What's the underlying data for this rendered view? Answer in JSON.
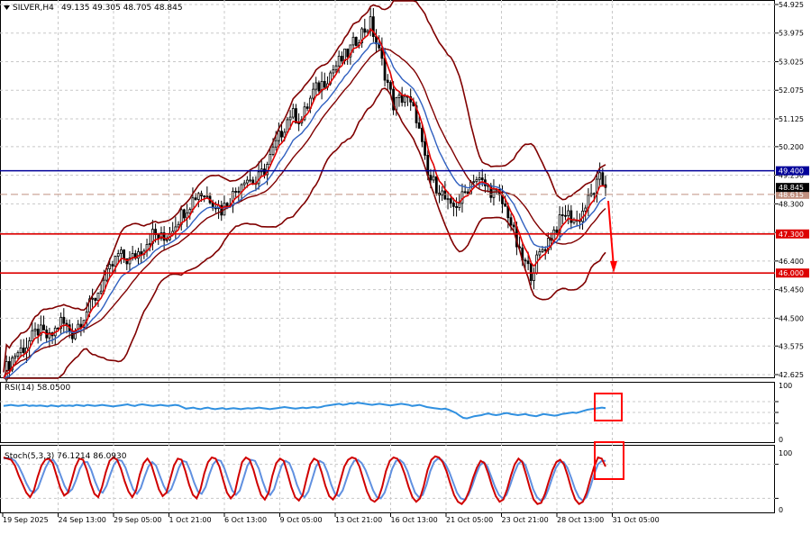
{
  "header": {
    "symbol": "SILVER,H4",
    "ohlc": "49.135 49.305 48.705 48.845",
    "rsi_label": "RSI(14) 58.0500",
    "stoch_label": "Stoch(5,3,3) 76.1214 86.0930"
  },
  "colors": {
    "background": "#ffffff",
    "grid": "#c8c8c8",
    "candles": "#000000",
    "bollinger": "#800000",
    "ema_fast": "#e00000",
    "ema_slow": "#3060c0",
    "horizontal_blue": "#000099",
    "horizontal_red": "#dd0000",
    "dashed_level": "#c09080",
    "rsi_line": "#3090e0",
    "stoch_main": "#d00000",
    "stoch_signal": "#6090e0",
    "annotation": "#ff0000"
  },
  "chart_data": [
    {
      "type": "candlestick",
      "title": "SILVER,H4",
      "ylim": [
        42.625,
        54.925
      ],
      "y_ticks": [
        "54.925",
        "53.975",
        "53.025",
        "52.075",
        "51.125",
        "50.200",
        "49.250",
        "48.300",
        "47.350",
        "46.400",
        "45.450",
        "44.500",
        "43.575",
        "42.625"
      ],
      "x_ticks": [
        "19 Sep 2025",
        "24 Sep 13:00",
        "29 Sep 05:00",
        "1 Oct 21:00",
        "6 Oct 13:00",
        "9 Oct 05:00",
        "13 Oct 21:00",
        "16 Oct 13:00",
        "21 Oct 05:00",
        "23 Oct 21:00",
        "28 Oct 13:00",
        "31 Oct 05:00"
      ],
      "price_path": [
        [
          0,
          42.7
        ],
        [
          4,
          43.3
        ],
        [
          8,
          43.6
        ],
        [
          12,
          44.1
        ],
        [
          16,
          43.8
        ],
        [
          20,
          44.4
        ],
        [
          24,
          44.0
        ],
        [
          28,
          44.6
        ],
        [
          32,
          45.2
        ],
        [
          36,
          45.9
        ],
        [
          40,
          46.6
        ],
        [
          44,
          46.4
        ],
        [
          48,
          46.8
        ],
        [
          52,
          47.3
        ],
        [
          56,
          47.1
        ],
        [
          60,
          47.7
        ],
        [
          64,
          48.2
        ],
        [
          68,
          48.7
        ],
        [
          72,
          48.5
        ],
        [
          76,
          48.1
        ],
        [
          80,
          48.6
        ],
        [
          84,
          49.2
        ],
        [
          88,
          49.0
        ],
        [
          92,
          49.6
        ],
        [
          96,
          50.5
        ],
        [
          100,
          51.3
        ],
        [
          104,
          51.1
        ],
        [
          108,
          52.0
        ],
        [
          112,
          52.4
        ],
        [
          116,
          52.9
        ],
        [
          120,
          53.3
        ],
        [
          124,
          53.9
        ],
        [
          128,
          54.3
        ],
        [
          132,
          53.0
        ],
        [
          136,
          51.6
        ],
        [
          140,
          51.9
        ],
        [
          144,
          51.2
        ],
        [
          148,
          49.2
        ],
        [
          152,
          48.8
        ],
        [
          156,
          48.1
        ],
        [
          160,
          48.5
        ],
        [
          164,
          49.2
        ],
        [
          168,
          48.9
        ],
        [
          172,
          48.6
        ],
        [
          176,
          48.0
        ],
        [
          180,
          46.6
        ],
        [
          184,
          46.0
        ],
        [
          188,
          46.8
        ],
        [
          192,
          47.4
        ],
        [
          196,
          48.0
        ],
        [
          200,
          47.7
        ],
        [
          204,
          48.4
        ],
        [
          208,
          49.1
        ],
        [
          210,
          48.85
        ]
      ],
      "last_price": "48.845",
      "levels": [
        {
          "value": 49.4,
          "label": "49.400",
          "color": "#000099"
        },
        {
          "value": 47.3,
          "label": "47.300",
          "color": "#dd0000"
        },
        {
          "value": 46.0,
          "label": "46.000",
          "color": "#dd0000"
        },
        {
          "value": 48.615,
          "label": "48.615",
          "color": "#c09080",
          "dashed": true
        },
        {
          "value": 48.845,
          "label": "48.845",
          "color": "#000000"
        }
      ],
      "bollinger_period": 20
    },
    {
      "type": "line",
      "title": "RSI(14) 58.0500",
      "ylim": [
        0,
        100
      ],
      "y_ticks": [
        "100",
        "0"
      ],
      "levels": [
        70,
        50,
        30
      ],
      "values": [
        62,
        63,
        64,
        63,
        62,
        63,
        64,
        62,
        63,
        62,
        63,
        62,
        61,
        63,
        62,
        61,
        63,
        62,
        63,
        62,
        64,
        63,
        62,
        64,
        63,
        62,
        63,
        64,
        63,
        62,
        61,
        62,
        63,
        64,
        65,
        63,
        62,
        64,
        65,
        64,
        63,
        62,
        63,
        64,
        63,
        62,
        63,
        64,
        63,
        60,
        57,
        58,
        59,
        57,
        56,
        58,
        59,
        57,
        56,
        57,
        58,
        56,
        57,
        58,
        57,
        56,
        57,
        58,
        57,
        58,
        59,
        58,
        57,
        56,
        57,
        58,
        59,
        60,
        59,
        58,
        57,
        58,
        59,
        58,
        59,
        60,
        59,
        60,
        62,
        63,
        64,
        65,
        66,
        64,
        65,
        67,
        66,
        68,
        67,
        66,
        65,
        64,
        65,
        66,
        65,
        64,
        63,
        64,
        65,
        66,
        65,
        64,
        62,
        63,
        64,
        62,
        60,
        59,
        58,
        57,
        56,
        57,
        55,
        52,
        49,
        44,
        40,
        39,
        41,
        43,
        44,
        45,
        47,
        48,
        46,
        45,
        46,
        48,
        49,
        47,
        46,
        45,
        46,
        47,
        45,
        44,
        43,
        45,
        47,
        46,
        45,
        44,
        45,
        47,
        48,
        49,
        50,
        49,
        51,
        53,
        55,
        56,
        57,
        58,
        59,
        58
      ],
      "last_value": "58.0500"
    },
    {
      "type": "line",
      "title": "Stoch(5,3,3) 76.1214 86.0930",
      "ylim": [
        0,
        100
      ],
      "y_ticks": [
        "100",
        "0"
      ],
      "levels": [
        80,
        20
      ],
      "series": [
        {
          "name": "Main",
          "values": [
            92,
            90,
            88,
            78,
            60,
            45,
            30,
            22,
            34,
            58,
            78,
            88,
            90,
            82,
            60,
            38,
            25,
            30,
            52,
            76,
            90,
            88,
            70,
            46,
            28,
            22,
            40,
            66,
            86,
            92,
            88,
            72,
            50,
            32,
            22,
            34,
            62,
            82,
            90,
            80,
            58,
            36,
            24,
            30,
            54,
            78,
            90,
            88,
            68,
            44,
            26,
            20,
            36,
            64,
            84,
            92,
            90,
            76,
            52,
            30,
            20,
            28,
            58,
            84,
            92,
            88,
            70,
            46,
            26,
            18,
            30,
            60,
            82,
            90,
            86,
            64,
            40,
            22,
            16,
            26,
            54,
            80,
            90,
            86,
            66,
            42,
            24,
            18,
            28,
            52,
            76,
            88,
            92,
            90,
            76,
            54,
            32,
            18,
            14,
            20,
            40,
            68,
            86,
            92,
            90,
            80,
            62,
            40,
            22,
            14,
            20,
            42,
            70,
            88,
            94,
            92,
            84,
            68,
            46,
            26,
            14,
            10,
            18,
            34,
            56,
            74,
            86,
            82,
            64,
            42,
            24,
            14,
            18,
            36,
            60,
            80,
            90,
            84,
            62,
            38,
            18,
            10,
            12,
            28,
            50,
            70,
            84,
            88,
            80,
            60,
            36,
            18,
            10,
            14,
            30,
            54,
            76,
            92,
            90,
            76
          ],
          "last_value": "76.1214"
        },
        {
          "name": "Signal",
          "values": [
            90,
            91,
            90,
            86,
            76,
            62,
            46,
            34,
            30,
            38,
            56,
            74,
            86,
            88,
            78,
            60,
            42,
            30,
            36,
            52,
            72,
            84,
            84,
            70,
            50,
            34,
            30,
            42,
            62,
            80,
            88,
            86,
            74,
            54,
            36,
            28,
            38,
            58,
            76,
            84,
            78,
            60,
            42,
            30,
            36,
            54,
            74,
            86,
            84,
            68,
            48,
            32,
            28,
            40,
            62,
            80,
            88,
            86,
            72,
            52,
            34,
            26,
            34,
            56,
            78,
            88,
            86,
            72,
            50,
            32,
            26,
            36,
            58,
            78,
            86,
            82,
            66,
            44,
            28,
            22,
            32,
            54,
            76,
            86,
            82,
            66,
            44,
            28,
            24,
            34,
            54,
            74,
            86,
            88,
            82,
            70,
            52,
            34,
            22,
            20,
            30,
            50,
            72,
            86,
            88,
            82,
            68,
            48,
            30,
            22,
            26,
            44,
            68,
            84,
            90,
            88,
            80,
            66,
            48,
            30,
            20,
            18,
            26,
            42,
            62,
            78,
            84,
            76,
            58,
            40,
            26,
            20,
            26,
            44,
            64,
            80,
            86,
            78,
            58,
            36,
            22,
            16,
            20,
            36,
            56,
            74,
            84,
            84,
            74,
            56,
            36,
            22,
            16,
            22,
            40,
            62,
            80,
            86,
            86
          ],
          "last_value": "86.0930"
        }
      ],
      "last_value": "76.1214"
    }
  ]
}
